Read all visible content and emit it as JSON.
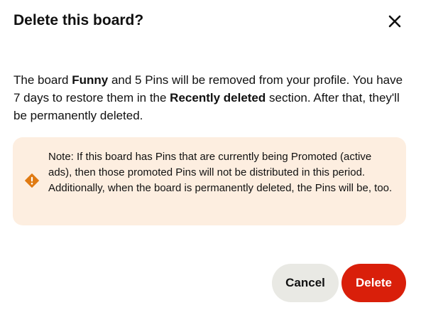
{
  "dialog": {
    "title": "Delete this board?",
    "close_icon": "close-icon",
    "message": {
      "part1": "The board ",
      "board_name": "Funny",
      "part2": " and 5 Pins will be removed from your profile. You have 7 days to restore them in the ",
      "section_name": "Recently deleted",
      "part3": " section. After that, they'll be permanently deleted."
    },
    "note": {
      "icon": "warning-icon",
      "text": "Note: If this board has Pins that are currently being Promoted (active ads), then those promoted Pins will not be distributed in this period. Additionally, when the board is permanently deleted, the Pins will be, too."
    },
    "buttons": {
      "cancel_label": "Cancel",
      "delete_label": "Delete"
    }
  },
  "colors": {
    "delete_button": "#d91f0a",
    "cancel_button": "#e9e9e4",
    "note_background": "#fdeee0",
    "warning_icon": "#e07a12"
  }
}
